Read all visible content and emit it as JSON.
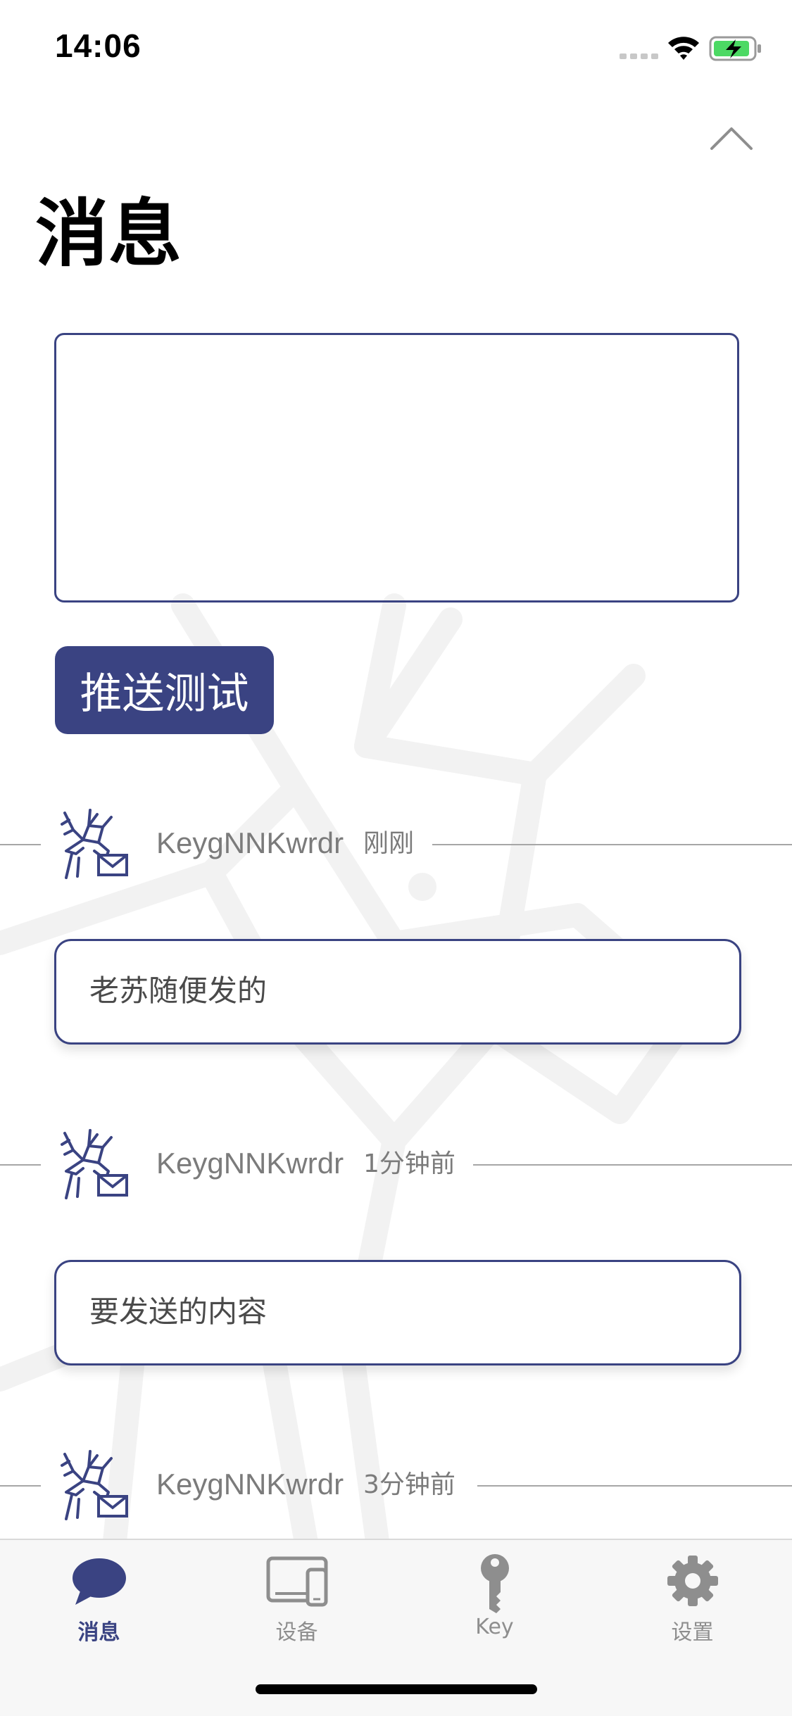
{
  "status_bar": {
    "time": "14:06"
  },
  "page": {
    "title": "消息"
  },
  "compose": {
    "placeholder": "",
    "push_button_label": "推送测试"
  },
  "messages": [
    {
      "sender": "KeygNNKwrdr",
      "time": "刚刚",
      "content": "老苏随便发的"
    },
    {
      "sender": "KeygNNKwrdr",
      "time": "1分钟前",
      "content": "要发送的内容"
    },
    {
      "sender": "KeygNNKwrdr",
      "time": "3分钟前",
      "content": ""
    }
  ],
  "tab_bar": {
    "tabs": [
      {
        "label": "消息",
        "icon": "chat-bubble-icon",
        "active": true
      },
      {
        "label": "设备",
        "icon": "devices-icon",
        "active": false
      },
      {
        "label": "Key",
        "icon": "key-icon",
        "active": false
      },
      {
        "label": "设置",
        "icon": "gear-icon",
        "active": false
      }
    ]
  },
  "colors": {
    "accent": "#3a4382",
    "muted_text": "#7b7b7b",
    "divider": "#a6a6a6",
    "tab_inactive": "#8e8e8e"
  }
}
